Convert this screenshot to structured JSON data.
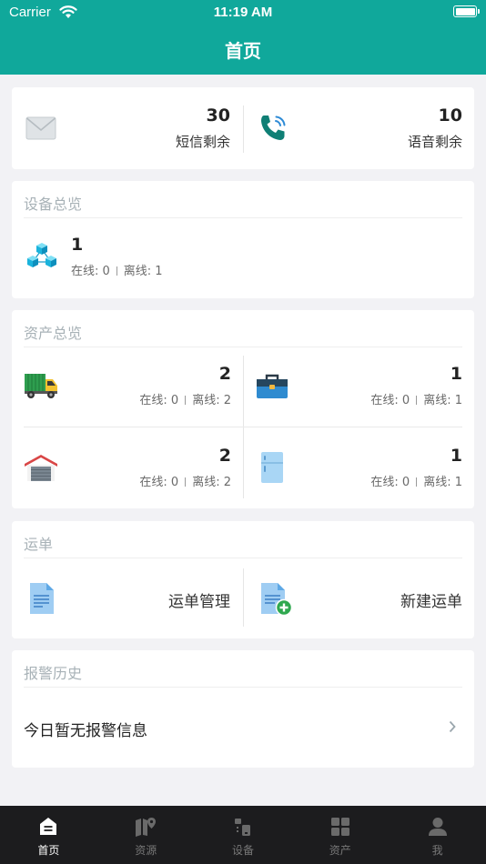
{
  "status_bar": {
    "carrier": "Carrier",
    "time": "11:19 AM"
  },
  "header": {
    "title": "首页"
  },
  "messages": {
    "sms": {
      "count": "30",
      "label": "短信剩余"
    },
    "voice": {
      "count": "10",
      "label": "语音剩余"
    }
  },
  "devices": {
    "title": "设备总览",
    "count": "1",
    "online": "在线: 0",
    "offline": "离线: 1"
  },
  "assets": {
    "title": "资产总览",
    "items": [
      {
        "icon": "truck-icon",
        "count": "2",
        "online": "在线: 0",
        "offline": "离线: 2"
      },
      {
        "icon": "toolbox-icon",
        "count": "1",
        "online": "在线: 0",
        "offline": "离线: 1"
      },
      {
        "icon": "warehouse-icon",
        "count": "2",
        "online": "在线: 0",
        "offline": "离线: 2"
      },
      {
        "icon": "fridge-icon",
        "count": "1",
        "online": "在线: 0",
        "offline": "离线: 1"
      }
    ]
  },
  "waybill": {
    "title": "运单",
    "manage_label": "运单管理",
    "new_label": "新建运单"
  },
  "alarms": {
    "title": "报警历史",
    "empty_text": "今日暂无报警信息"
  },
  "tabbar": {
    "tabs": [
      {
        "label": "首页",
        "active": true
      },
      {
        "label": "资源"
      },
      {
        "label": "设备"
      },
      {
        "label": "资产"
      },
      {
        "label": "我"
      }
    ]
  },
  "colors": {
    "header": "#10a89b",
    "tabbar": "#1c1c1e"
  }
}
